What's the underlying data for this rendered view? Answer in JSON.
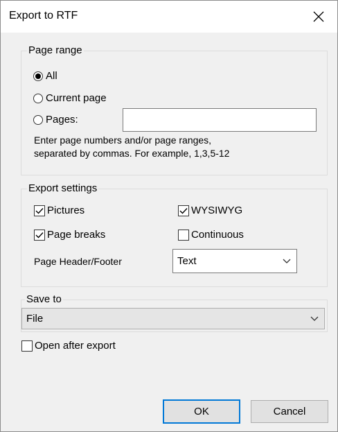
{
  "dialog": {
    "title": "Export to RTF"
  },
  "page_range": {
    "legend": "Page range",
    "options": [
      "All",
      "Current page",
      "Pages:"
    ],
    "selected": "All",
    "pages_value": "",
    "hint_line1": "Enter page numbers and/or page ranges,",
    "hint_line2": "separated by commas. For example, 1,3,5-12"
  },
  "export_settings": {
    "legend": "Export settings",
    "pictures": {
      "label": "Pictures",
      "checked": true
    },
    "wysiwyg": {
      "label": "WYSIWYG",
      "checked": true
    },
    "page_breaks": {
      "label": "Page breaks",
      "checked": true
    },
    "continuous": {
      "label": "Continuous",
      "checked": false
    },
    "header_footer_label": "Page Header/Footer",
    "header_footer_value": "Text"
  },
  "save_to": {
    "legend": "Save to",
    "value": "File"
  },
  "open_after": {
    "label": "Open after export",
    "checked": false
  },
  "buttons": {
    "ok": "OK",
    "cancel": "Cancel"
  }
}
